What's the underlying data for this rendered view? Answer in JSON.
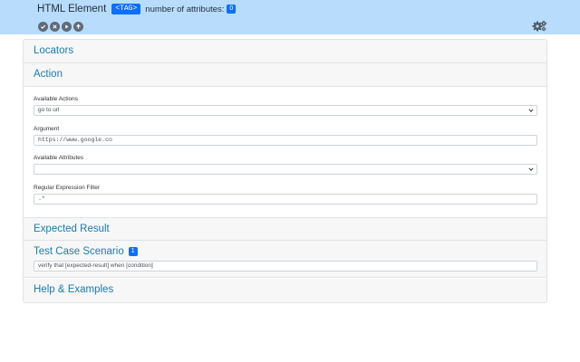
{
  "header": {
    "title": "HTML Element",
    "tag_badge": "<TAG>",
    "attributes_label": "number of attributes:",
    "attributes_count": "0",
    "controls": [
      {
        "icon": "check-circle-icon"
      },
      {
        "icon": "close-circle-icon"
      },
      {
        "icon": "play-circle-icon"
      },
      {
        "icon": "arrow-up-circle-icon"
      }
    ],
    "settings_icon": "gears-icon"
  },
  "sections": {
    "locators": {
      "title": "Locators"
    },
    "action": {
      "title": "Action",
      "available_actions": {
        "label": "Available Actions",
        "value": "go to url"
      },
      "argument": {
        "label": "Argument",
        "value": "https://www.google.co"
      },
      "available_attributes": {
        "label": "Available Attributes",
        "value": ""
      },
      "regex_filter": {
        "label": "Regular Expression Filter",
        "value": ".*"
      }
    },
    "expected_result": {
      "title": "Expected Result"
    },
    "test_case_scenario": {
      "title": "Test Case Scenario",
      "count": "1",
      "value": "verify that [expected-result] when [condition]"
    },
    "help": {
      "title": "Help & Examples"
    }
  },
  "colors": {
    "header_bg": "#b8dcfc",
    "badge": "#0d6efd",
    "section_title": "#1a7cb0"
  }
}
